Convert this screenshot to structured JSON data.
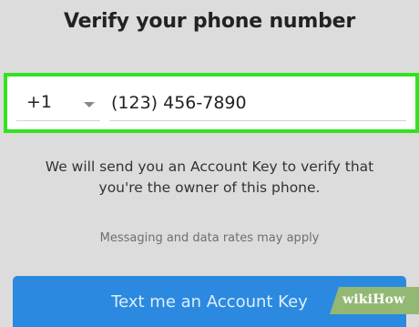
{
  "header": {
    "title": "Verify your phone number"
  },
  "phone_form": {
    "country_code": "+1",
    "phone_number": "(123) 456-7890"
  },
  "info_text_line1": "We will send you an Account Key to verify that",
  "info_text_line2": "you're the owner of this phone.",
  "rates_text": "Messaging and data rates may apply",
  "send_button": {
    "label": "Text me an Account Key"
  },
  "watermark": {
    "text": "wikiHow"
  },
  "colors": {
    "background": "#dcdcdc",
    "highlight_border": "#33e21f",
    "button": "#2b8ae0",
    "watermark_green": "#93b874"
  },
  "icons": {
    "dropdown": "chevron-down-icon"
  }
}
